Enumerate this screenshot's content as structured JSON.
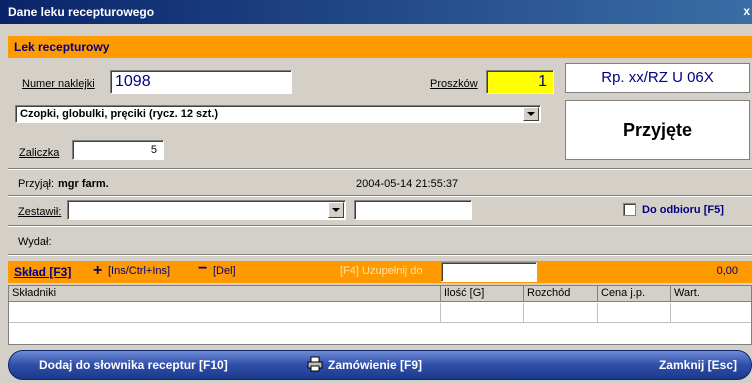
{
  "window": {
    "title": "Dane leku recepturowego",
    "close": "x"
  },
  "section_main": {
    "title": "Lek recepturowy"
  },
  "sticker": {
    "label": "Numer naklejki",
    "value": "1098"
  },
  "powders": {
    "label": "Proszków",
    "value": "1"
  },
  "rx_number": "Rp. xx/RZ U 06X",
  "form_select": {
    "value": "Czopki, globulki, pręciki (rycz. 12 szt.)"
  },
  "status": "Przyjęte",
  "advance": {
    "label": "Zaliczka",
    "value": "5"
  },
  "accepted": {
    "label": "Przyjął:",
    "person": "mgr farm.",
    "datetime": "2004-05-14 21:55:37"
  },
  "composed": {
    "label": "Zestawił:",
    "value": "",
    "extra": ""
  },
  "pickup": {
    "label": "Do odbioru [F5]"
  },
  "issued": {
    "label": "Wydał:"
  },
  "composition": {
    "title": "Skład [F3]",
    "add_label": "[Ins/Ctrl+Ins]",
    "del_label": "[Del]",
    "fill_label": "[F4] Uzupełnij do",
    "fill_value": "",
    "total": "0,00"
  },
  "table": {
    "columns": [
      "Składniki",
      "Ilość [G]",
      "Rozchód",
      "Cena j.p.",
      "Wart."
    ]
  },
  "bottom": {
    "add_dict": "Dodaj do słownika receptur [F10]",
    "order": "Zamówienie [F9]",
    "close": "Zamknij [Esc]"
  },
  "colors": {
    "accent": "#ff9900",
    "title_bar": "#0a246a",
    "highlight": "#ffff00",
    "text_blue": "#000080"
  }
}
